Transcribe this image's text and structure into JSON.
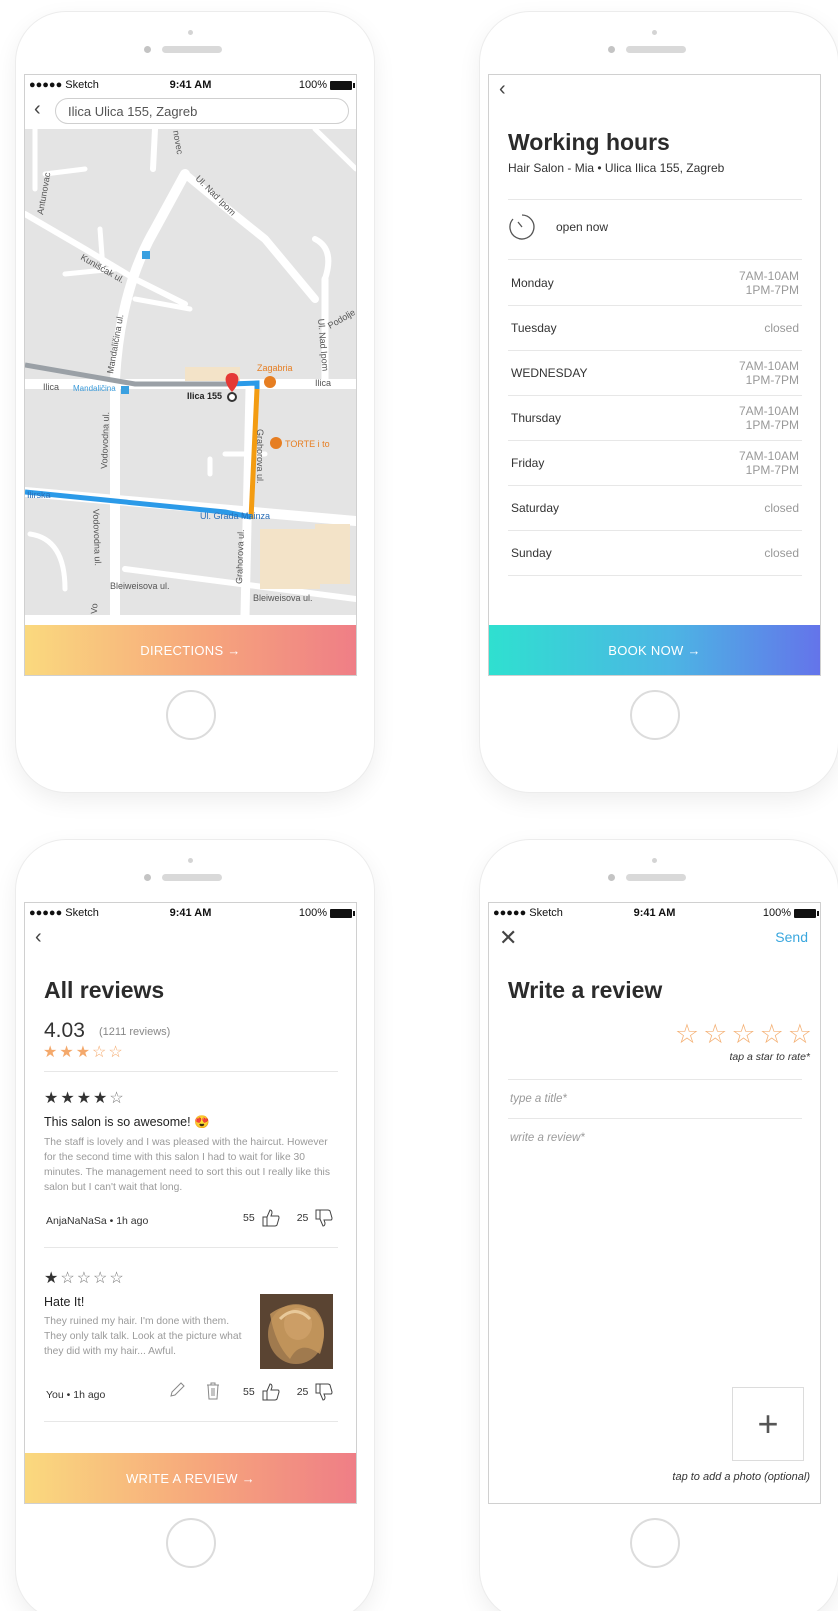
{
  "status": {
    "carrier": "●●●●● Sketch",
    "time": "9:41 AM",
    "battery": "100%"
  },
  "map_screen": {
    "search_value": "Ilica Ulica 155, Zagreb",
    "cta": "DIRECTIONS →",
    "labels": {
      "street_ilica_left": "Ilica",
      "tram_stop": "Mandaličina",
      "pin_label": "Ilica 155",
      "zagabria": "Zagabria",
      "ilica_right": "Ilica",
      "torte": "TORTE i to",
      "ilirska": "Ilirska",
      "grada": "Ul. Grada Mainza",
      "bleiweisova_left": "Bleiweisova ul.",
      "bleiweisova_right": "Bleiweisova ul.",
      "antunovac": "Antunovac",
      "kunisak": "Kunišćak ul.",
      "nad_ipom": "Ul. Nad Ipom",
      "nad_ipom2": "Ul. Nad Ipom",
      "podolje": "Podolje",
      "mandalicina": "Mandaličina ul.",
      "vodovodna": "Vodovodna ul.",
      "vodovodna2": "Vodovodna ul.",
      "grahorova": "Grahorova ul.",
      "grahorova2": "Grahorova ul.",
      "novec": "novec",
      "vo": "Vo"
    },
    "colors": {
      "route_blue": "#2b9ae8",
      "route_orange": "#f39c12",
      "pin": "#e53935",
      "poi": "#e67e22"
    }
  },
  "hours_screen": {
    "title": "Working hours",
    "subtitle": "Hair Salon - Mia • Ulica Ilica 155, Zagreb",
    "open_status": "open now",
    "days": [
      {
        "day": "Monday",
        "line1": "7AM-10AM",
        "line2": "1PM-7PM"
      },
      {
        "day": "Tuesday",
        "line1": "closed",
        "line2": ""
      },
      {
        "day": "WEDNESDAY",
        "line1": "7AM-10AM",
        "line2": "1PM-7PM"
      },
      {
        "day": "Thursday",
        "line1": "7AM-10AM",
        "line2": "1PM-7PM"
      },
      {
        "day": "Friday",
        "line1": "7AM-10AM",
        "line2": "1PM-7PM"
      },
      {
        "day": "Saturday",
        "line1": "closed",
        "line2": ""
      },
      {
        "day": "Sunday",
        "line1": "closed",
        "line2": ""
      }
    ],
    "cta": "BOOK NOW →"
  },
  "reviews_screen": {
    "title": "All reviews",
    "score": "4.03",
    "count": "(1211 reviews)",
    "overall_stars": 3,
    "reviews": [
      {
        "stars": 4,
        "title": "This salon is so awesome! 😍",
        "body": "The staff is lovely and I was pleased with the haircut. However for the second time with this salon I had to wait for like 30 minutes. The management need to sort this out I really like this salon but I can't wait that long.",
        "author": "AnjaNaNaSa • 1h ago",
        "likes": "55",
        "dislikes": "25"
      },
      {
        "stars": 1,
        "title": "Hate It!",
        "body": "They ruined my hair. I'm done with them. They only talk talk. Look at the picture what they did with my hair... Awful.",
        "author": "You • 1h ago",
        "likes": "55",
        "dislikes": "25"
      }
    ],
    "cta": "WRITE A REVIEW →"
  },
  "write_screen": {
    "send": "Send",
    "title": "Write a review",
    "rate_hint": "tap a star to rate*",
    "title_placeholder": "type a title*",
    "review_placeholder": "write a review*",
    "photo_hint": "tap to add a photo (optional)"
  }
}
